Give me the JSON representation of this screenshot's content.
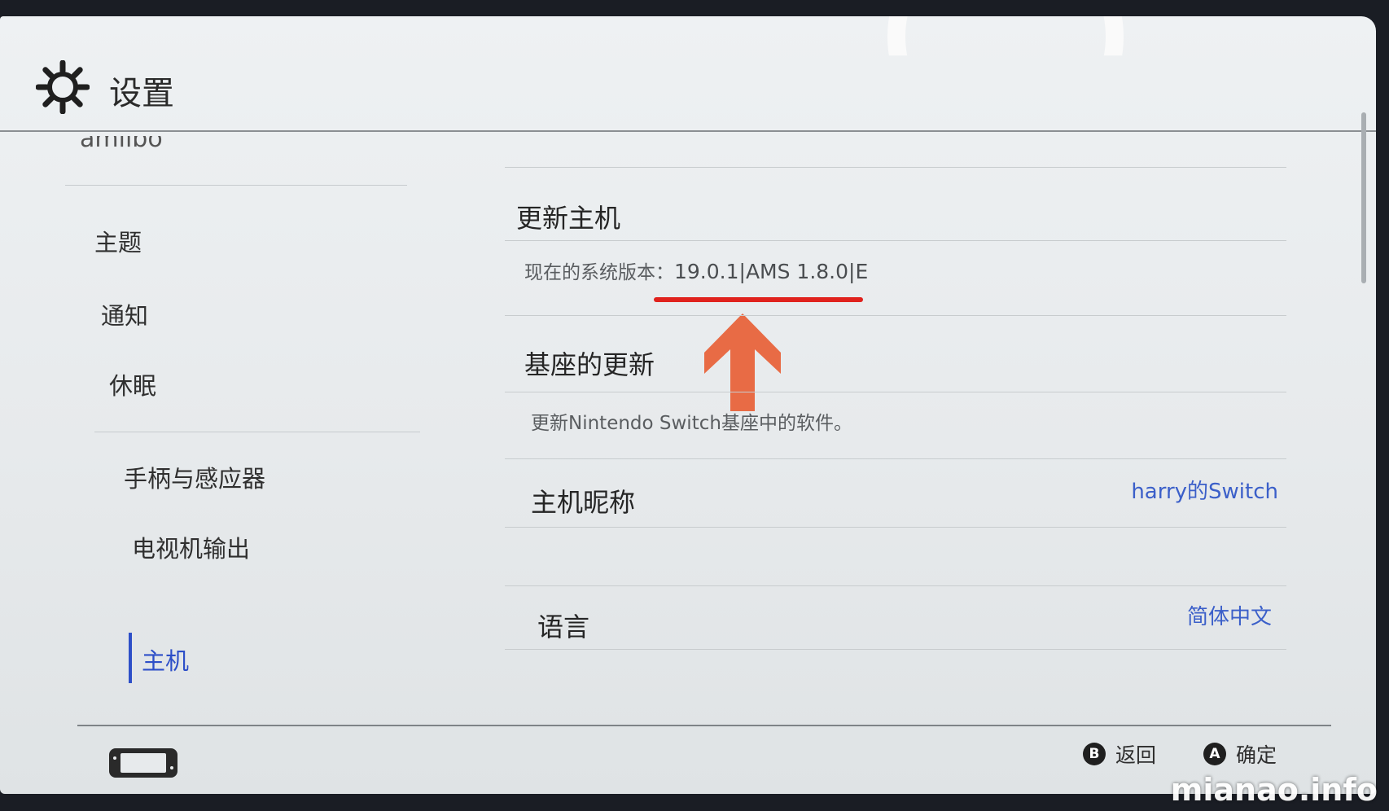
{
  "header": {
    "title": "设置"
  },
  "sidebar": {
    "cut_item": "amiibo",
    "items": [
      {
        "label": "主题"
      },
      {
        "label": "通知"
      },
      {
        "label": "休眠"
      },
      {
        "label": "手柄与感应器"
      },
      {
        "label": "电视机输出"
      },
      {
        "label": "主机",
        "active": true
      }
    ]
  },
  "content": {
    "update": {
      "title": "更新主机",
      "version_label": "现在的系统版本：",
      "version_value": "19.0.1|AMS 1.8.0|E"
    },
    "dock": {
      "title": "基座的更新",
      "desc": "更新Nintendo Switch基座中的软件。"
    },
    "nickname": {
      "title": "主机昵称",
      "value": "harry的Switch"
    },
    "language": {
      "title": "语言",
      "value": "简体中文"
    }
  },
  "footer": {
    "back_button": {
      "glyph": "B",
      "label": "返回"
    },
    "ok_button": {
      "glyph": "A",
      "label": "确定"
    }
  },
  "watermark": "mianao.info",
  "colors": {
    "accent": "#2d4fc8",
    "annotation": "#e0221d",
    "arrow": "#e86b45"
  },
  "icons": {
    "settings": "gear-icon",
    "console": "console-icon",
    "arrow": "up-arrow-icon"
  }
}
